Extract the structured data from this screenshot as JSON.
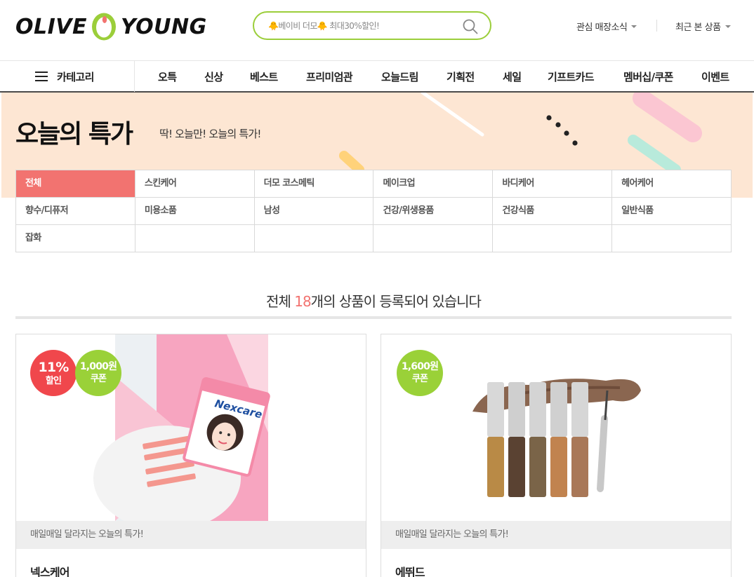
{
  "header": {
    "logo_left": "OLIVE",
    "logo_right": "YOUNG",
    "search": {
      "placeholder": "🐥베이비 더모🐥 최대30%할인!"
    },
    "links": [
      {
        "label": "관심 매장소식"
      },
      {
        "label": "최근 본 상품"
      }
    ]
  },
  "gnb": {
    "category_label": "카테고리",
    "items": [
      {
        "label": "오특"
      },
      {
        "label": "신상"
      },
      {
        "label": "베스트"
      },
      {
        "label": "프리미엄관"
      },
      {
        "label": "오늘드림"
      },
      {
        "label": "기획전"
      },
      {
        "label": "세일"
      },
      {
        "label": "기프트카드"
      },
      {
        "label": "멤버십/쿠폰"
      },
      {
        "label": "이벤트"
      }
    ]
  },
  "banner": {
    "title": "오늘의 특가",
    "subtitle": "딱! 오늘만! 오늘의 특가!"
  },
  "categories": {
    "active": "전체",
    "rows": [
      [
        "전체",
        "스킨케어",
        "더모 코스메틱",
        "메이크업",
        "바디케어",
        "헤어케어"
      ],
      [
        "향수/디퓨저",
        "미용소품",
        "남성",
        "건강/위생용품",
        "건강식품",
        "일반식품"
      ],
      [
        "잡화",
        "",
        "",
        "",
        "",
        ""
      ]
    ]
  },
  "summary": {
    "prefix": "전체 ",
    "count": "18",
    "suffix": "개의 상품이 등록되어 있습니다"
  },
  "products": [
    {
      "badges": [
        {
          "line1": "11%",
          "line2": "할인",
          "color": "#f0474c"
        },
        {
          "line1": "1,000원",
          "line2": "쿠폰",
          "color": "#9ad138"
        }
      ],
      "strip": "매일매일 달라지는 오늘의 특가!",
      "brand": "넥스케어",
      "package_text": "Nexcare"
    },
    {
      "badges": [
        {
          "line1": "1,600원",
          "line2": "쿠폰",
          "color": "#9ad138"
        }
      ],
      "strip": "매일매일 달라지는 오늘의 특가!",
      "brand": "에뛰드"
    }
  ],
  "colors": {
    "accent_green": "#9bce3a",
    "accent_red": "#f27370",
    "banner_bg": "#fde6d3"
  }
}
